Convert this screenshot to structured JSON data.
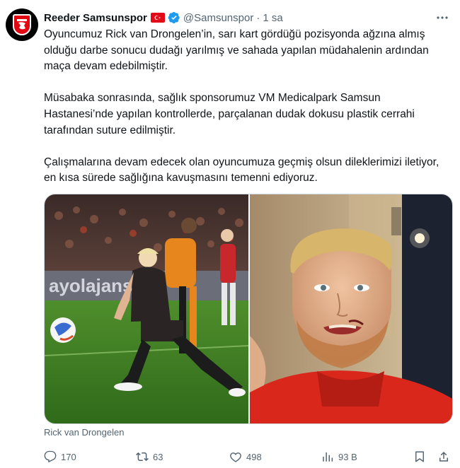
{
  "tweet": {
    "display_name": "Reeder Samsunspor",
    "handle": "@Samsunspor",
    "separator": "·",
    "time": "1 sa",
    "body": [
      "Oyuncumuz Rick van Drongelen’in, sarı kart gördüğü pozisyonda ağzına almış olduğu darbe sonucu dudağı yarılmış ve sahada yapılan müdahalenin ardından maça devam edebilmiştir.",
      "Müsabaka sonrasında, sağlık sponsorumuz VM Medicalpark Samsun Hastanesi’nde yapılan kontrollerde, parçalanan dudak dokusu plastik cerrahi tarafından suture edilmiştir.",
      "Çalışmalarına devam edecek olan oyuncumuza geçmiş olsun dileklerimizi iletiyor, en kısa sürede sağlığına kavuşmasını temenni ediyoruz."
    ],
    "media_caption": "Rick van Drongelen"
  },
  "actions": {
    "replies": "170",
    "retweets": "63",
    "likes": "498",
    "views": "93 B"
  },
  "icons": [
    "avatar-crest",
    "turkey-flag-icon",
    "verified-badge-icon",
    "more-options-icon",
    "reply-icon",
    "retweet-icon",
    "like-icon",
    "views-icon",
    "bookmark-icon",
    "share-icon"
  ],
  "colors": {
    "text": "#0f1419",
    "secondary": "#536471",
    "verified": "#1d9bf0",
    "club_red": "#e30613",
    "border": "#cfd9de"
  }
}
